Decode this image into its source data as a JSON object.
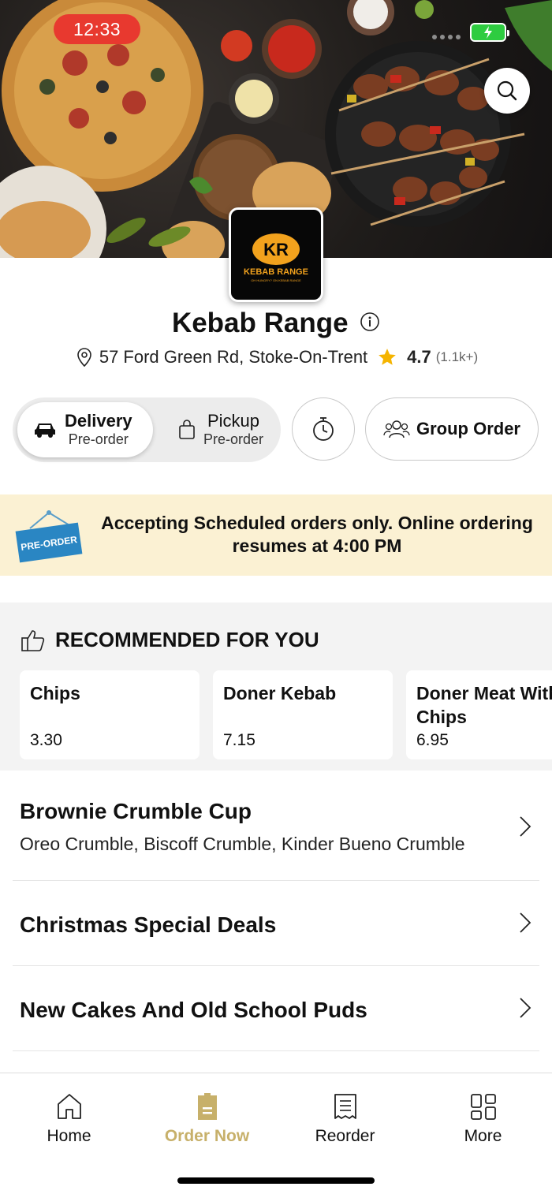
{
  "status_bar": {
    "time": "12:33"
  },
  "restaurant": {
    "name": "Kebab Range",
    "address": "57 Ford Green Rd, Stoke-On-Trent",
    "rating": "4.7",
    "rating_count": "(1.1k+)",
    "logo_text": "KR",
    "logo_brand": "KEBAB RANGE",
    "logo_tagline": "OH HUNGRY? ON KEBAB RANGE"
  },
  "order_type": {
    "delivery": {
      "label": "Delivery",
      "sub": "Pre-order"
    },
    "pickup": {
      "label": "Pickup",
      "sub": "Pre-order"
    },
    "group_order_label": "Group Order"
  },
  "banner": {
    "badge": "PRE-ORDER",
    "message": "Accepting Scheduled orders only. Online ordering resumes at 4:00 PM"
  },
  "recommended": {
    "title": "RECOMMENDED FOR YOU",
    "items": [
      {
        "name": "Chips",
        "price": "3.30"
      },
      {
        "name": "Doner Kebab",
        "price": "7.15"
      },
      {
        "name": "Doner Meat With Chips",
        "price": "6.95"
      }
    ]
  },
  "categories": [
    {
      "title": "Brownie Crumble Cup",
      "subtitle": "Oreo Crumble, Biscoff Crumble, Kinder Bueno Crumble"
    },
    {
      "title": "Christmas Special Deals",
      "subtitle": ""
    },
    {
      "title": "New Cakes And Old School Puds",
      "subtitle": ""
    }
  ],
  "bottom_nav": [
    {
      "label": "Home",
      "icon": "home-icon"
    },
    {
      "label": "Order Now",
      "icon": "order-icon"
    },
    {
      "label": "Reorder",
      "icon": "receipt-icon"
    },
    {
      "label": "More",
      "icon": "grid-icon"
    }
  ],
  "colors": {
    "accent": "#c7b06a",
    "banner_bg": "#fbf1d3",
    "status_pill": "#e8392f",
    "star": "#f5b400"
  }
}
